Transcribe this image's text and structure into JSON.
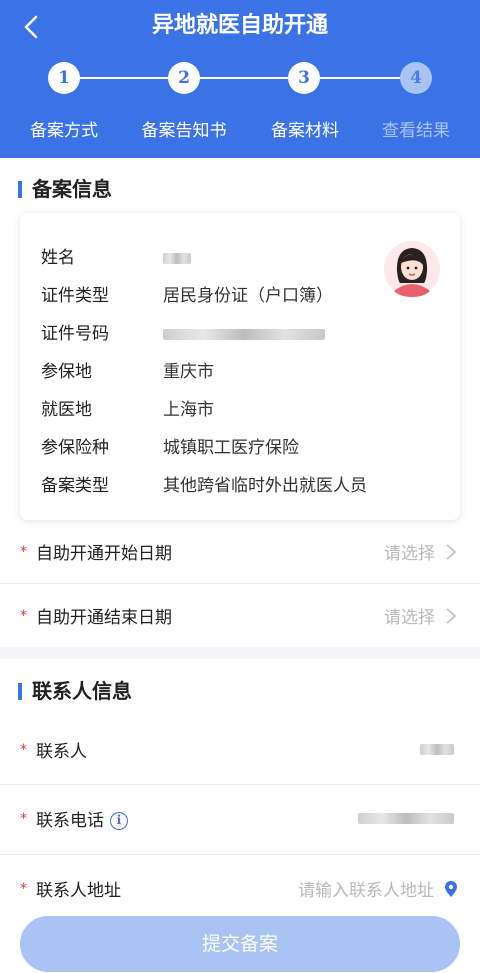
{
  "header": {
    "title": "异地就医自助开通",
    "steps": [
      {
        "number": "1",
        "label": "备案方式",
        "active": true
      },
      {
        "number": "2",
        "label": "备案告知书",
        "active": true
      },
      {
        "number": "3",
        "label": "备案材料",
        "active": true
      },
      {
        "number": "4",
        "label": "查看结果",
        "active": false
      }
    ]
  },
  "record_section": {
    "title": "备案信息",
    "fields": [
      {
        "label": "姓名",
        "value": ""
      },
      {
        "label": "证件类型",
        "value": "居民身份证（户口簿）"
      },
      {
        "label": "证件号码",
        "value": ""
      },
      {
        "label": "参保地",
        "value": "重庆市"
      },
      {
        "label": "就医地",
        "value": "上海市"
      },
      {
        "label": "参保险种",
        "value": "城镇职工医疗保险"
      },
      {
        "label": "备案类型",
        "value": "其他跨省临时外出就医人员"
      }
    ],
    "start_date": {
      "required": "*",
      "label": "自助开通开始日期",
      "placeholder": "请选择"
    },
    "end_date": {
      "required": "*",
      "label": "自助开通结束日期",
      "placeholder": "请选择"
    }
  },
  "contact_section": {
    "title": "联系人信息",
    "contact_name": {
      "required": "*",
      "label": "联系人",
      "value": ""
    },
    "contact_phone": {
      "required": "*",
      "label": "联系电话",
      "info_icon": "i",
      "value": ""
    },
    "contact_address": {
      "required": "*",
      "label": "联系人地址",
      "placeholder": "请输入联系人地址"
    }
  },
  "submit_label": "提交备案",
  "icons": {
    "back": "chevron-left-icon",
    "avatar": "female-avatar-icon",
    "chevron": "chevron-right-icon",
    "info": "info-circle-icon",
    "location": "location-pin-icon"
  },
  "colors": {
    "brand": "#3b73e6",
    "disabled": "#a9c3f2",
    "required": "#e53935",
    "placeholder": "#b9b9b9"
  }
}
